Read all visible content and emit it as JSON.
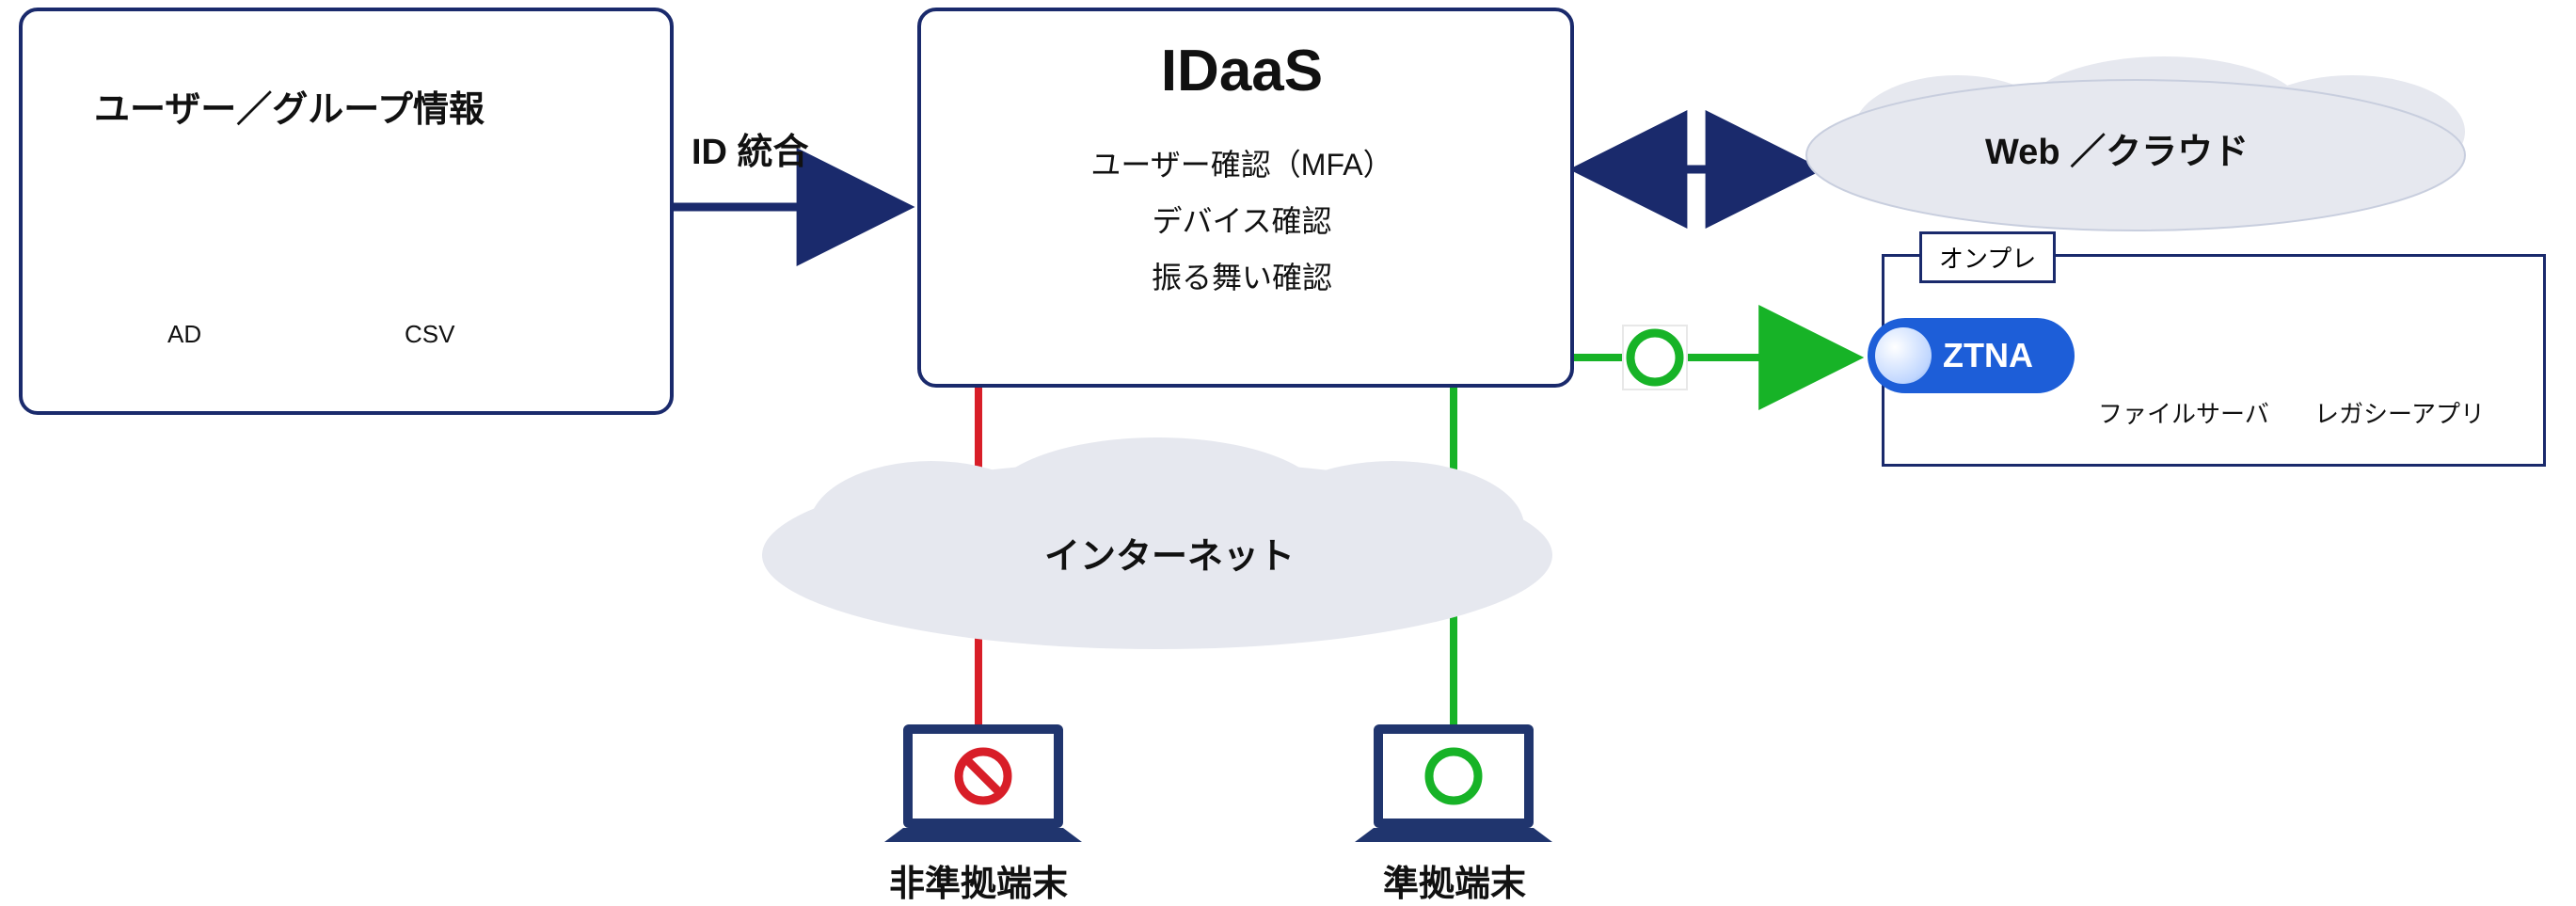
{
  "left_box": {
    "title": "ユーザー／グループ情報",
    "ad": "AD",
    "csv": "CSV"
  },
  "arrow1_label": "ID 統合",
  "idaas": {
    "title": "IDaaS",
    "line1": "ユーザー確認（MFA）",
    "line2": "デバイス確認",
    "line3": "振る舞い確認"
  },
  "cloud_right": "Web ／クラウド",
  "onprem_tag": "オンプレ",
  "ztna": "ZTNA",
  "file_server": "ファイルサーバ",
  "legacy_app": "レガシーアプリ",
  "internet": "インターネット",
  "noncompliant": "非準拠端末",
  "compliant": "準拠端末",
  "colors": {
    "border": "#1a2a6c",
    "deny": "#d81e28",
    "allow": "#17b327",
    "ztna": "#1d5ed8"
  }
}
